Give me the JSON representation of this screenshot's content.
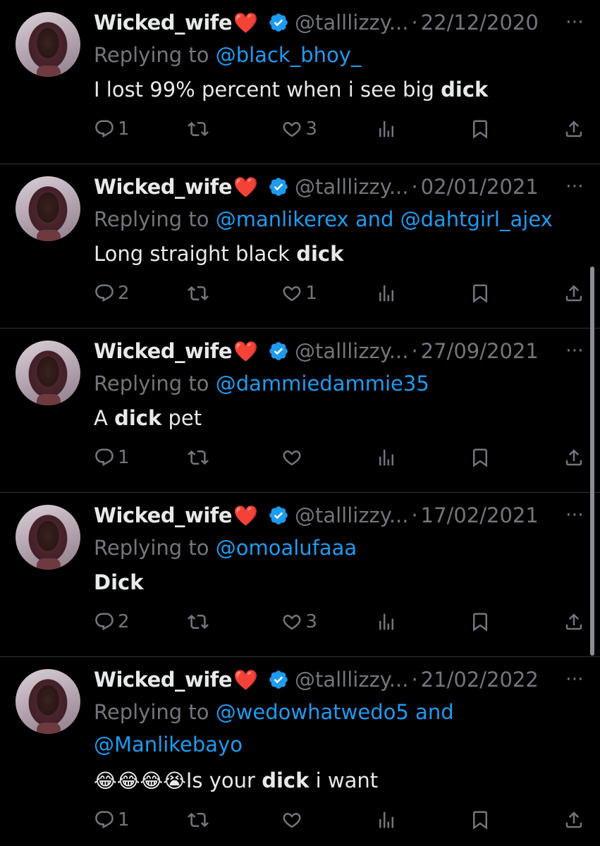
{
  "tweets": [
    {
      "name": "Wicked_wife",
      "heart": "❤️",
      "handle": "@talllizzy...",
      "date": "22/12/2020",
      "reply_prefix": "Replying to ",
      "reply_lines": [
        "@black_bhoy_"
      ],
      "text_before": "I lost 99% percent when i see big ",
      "text_bold": "dick",
      "text_after": "",
      "replies": "1",
      "retweets": "",
      "likes": "3"
    },
    {
      "name": "Wicked_wife",
      "heart": "❤️",
      "handle": "@talllizzy...",
      "date": "02/01/2021",
      "reply_prefix": "Replying to ",
      "reply_lines": [
        "@manlikerex and @dahtgirl_ajex"
      ],
      "text_before": "Long straight black ",
      "text_bold": "dick",
      "text_after": "",
      "replies": "2",
      "retweets": "",
      "likes": "1"
    },
    {
      "name": "Wicked_wife",
      "heart": "❤️",
      "handle": "@talllizzy...",
      "date": "27/09/2021",
      "reply_prefix": "Replying to ",
      "reply_lines": [
        "@dammiedammie35"
      ],
      "text_before": "A ",
      "text_bold": "dick",
      "text_after": " pet",
      "replies": "1",
      "retweets": "",
      "likes": ""
    },
    {
      "name": "Wicked_wife",
      "heart": "❤️",
      "handle": "@talllizzy...",
      "date": "17/02/2021",
      "reply_prefix": "Replying to ",
      "reply_lines": [
        "@omoalufaaa"
      ],
      "text_before": "",
      "text_bold": "Dick",
      "text_after": "",
      "replies": "2",
      "retweets": "",
      "likes": "3"
    },
    {
      "name": "Wicked_wife",
      "heart": "❤️",
      "handle": "@talllizzy...",
      "date": "21/02/2022",
      "reply_prefix": "Replying to ",
      "reply_lines": [
        "@wedowhatwedo5 and",
        "@Manlikebayo"
      ],
      "text_emoji": "😂😂😂😭",
      "text_before": "Is your ",
      "text_bold": "dick",
      "text_after": " i want",
      "replies": "1",
      "retweets": "",
      "likes": ""
    }
  ],
  "more_icon": "⋯",
  "colors": {
    "background": "#000000",
    "text": "#e7e9ea",
    "muted": "#71767b",
    "link": "#1d9bf0",
    "verified": "#1d9bf0",
    "divider": "#2f3336"
  }
}
